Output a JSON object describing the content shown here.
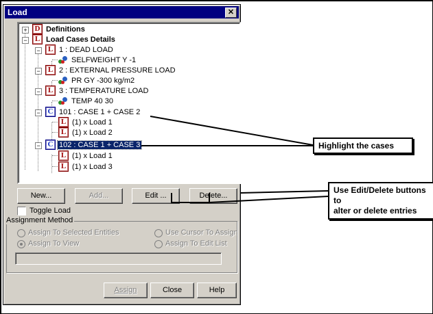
{
  "dialog": {
    "title": "Load",
    "close_symbol": "✕"
  },
  "tree": {
    "definitions": "Definitions",
    "load_cases_details": "Load Cases Details",
    "load1": "1 : DEAD LOAD",
    "load1_item": "SELFWEIGHT Y -1",
    "load2": "2 : EXTERNAL PRESSURE LOAD",
    "load2_item": "PR GY -300 kg/m2",
    "load3": "3 : TEMPERATURE LOAD",
    "load3_item": "TEMP 40 30",
    "case101": "101 : CASE 1  + CASE 2",
    "case101_item1": "(1) x Load 1",
    "case101_item2": "(1) x Load 2",
    "case102": "102 : CASE 1 + CASE 3",
    "case102_item1": "(1) x Load 1",
    "case102_item2": "(1) x Load 3",
    "icon_d": "D",
    "icon_l": "L",
    "icon_c": "C",
    "plus": "+",
    "minus": "−"
  },
  "buttons": {
    "new": "New...",
    "add": "Add...",
    "edit": "Edit ...",
    "delete": "Delete...",
    "assign": "Assign",
    "close": "Close",
    "help": "Help"
  },
  "options": {
    "toggle_load": "Toggle Load",
    "assignment_method": "Assignment Method",
    "assign_selected": "Assign To Selected Entities",
    "use_cursor": "Use Cursor To Assign",
    "assign_view": "Assign To View",
    "assign_edit_list": "Assign To Edit List"
  },
  "callouts": {
    "highlight": "Highlight the cases",
    "edit_delete_line1": "Use Edit/Delete buttons to",
    "edit_delete_line2": "alter or delete entries"
  },
  "colors": {
    "titlebar": "#000080",
    "selection": "#0a246a",
    "dialog_face": "#d4d0c8"
  }
}
